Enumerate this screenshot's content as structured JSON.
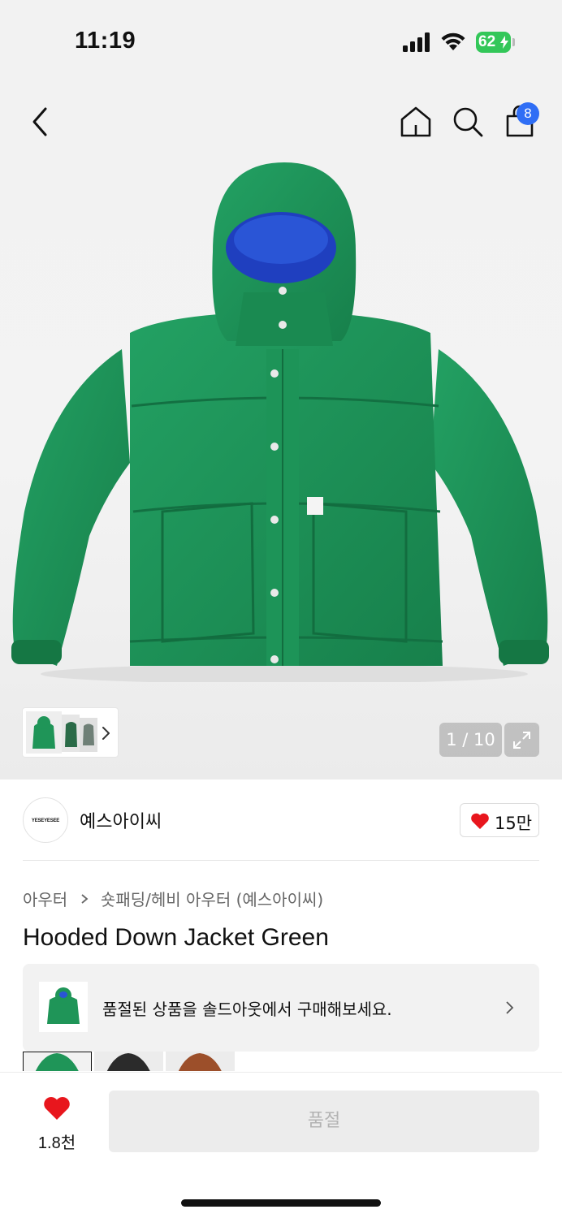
{
  "status_bar": {
    "time": "11:19",
    "battery_level": "62",
    "battery_charging": true,
    "battery_color": "#33c759"
  },
  "nav": {
    "back_icon": "chevron-left-icon",
    "home_icon": "home-icon",
    "search_icon": "search-icon",
    "bag_icon": "shopping-bag-icon",
    "bag_count": "8",
    "badge_color": "#2f6ef5"
  },
  "gallery": {
    "counter": "1 / 10",
    "expand_icon": "expand-icon"
  },
  "brand": {
    "logo_text": "YESEYESEE",
    "name": "예스아이씨",
    "like_count": "15만",
    "heart_color": "#e8161d"
  },
  "breadcrumb": {
    "category": "아우터",
    "subcategory": "숏패딩/헤비 아우터 (예스아이씨)"
  },
  "product": {
    "title": "Hooded Down Jacket Green",
    "color": "#1f9558"
  },
  "soldout_banner": {
    "text": "품절된 상품을 솔드아웃에서 구매해보세요."
  },
  "bottom_bar": {
    "wish_count": "1.8천",
    "buy_button_label": "품절"
  }
}
